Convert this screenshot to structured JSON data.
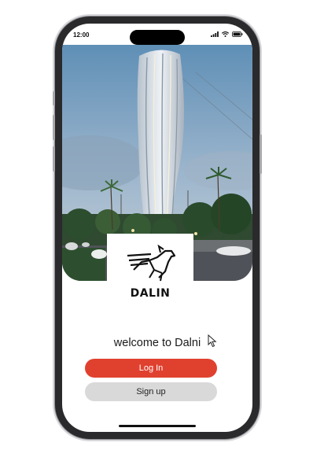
{
  "status_bar": {
    "time": "12:00",
    "icons": [
      "signal-icon",
      "wifi-icon",
      "battery-icon"
    ]
  },
  "hero": {
    "image": "skyscraper-tower-photo"
  },
  "brand": {
    "logo_icon": "winged-horse-logo-icon",
    "name": "DALIN"
  },
  "welcome": {
    "text": "welcome to Dalni"
  },
  "actions": {
    "login_label": "Log In",
    "signup_label": "Sign up"
  },
  "colors": {
    "primary": "#e0412f",
    "secondary": "#d9d9d9",
    "frame": "#2a2a2c"
  }
}
